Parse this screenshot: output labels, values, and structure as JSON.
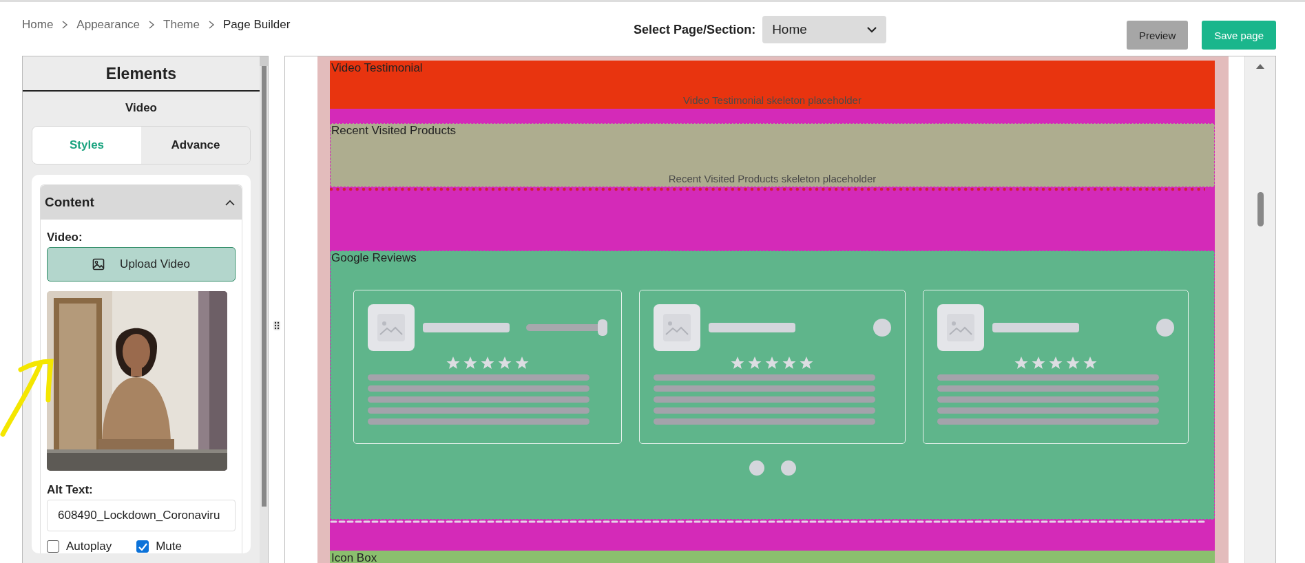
{
  "breadcrumb": [
    {
      "label": "Home",
      "current": false
    },
    {
      "label": "Appearance",
      "current": false
    },
    {
      "label": "Theme",
      "current": false
    },
    {
      "label": "Page Builder",
      "current": true
    }
  ],
  "page_select": {
    "label": "Select Page/Section:",
    "value": "Home"
  },
  "buttons": [
    {
      "label": "Preview",
      "kind": "secondary"
    },
    {
      "label": "Save page",
      "kind": "primary"
    }
  ],
  "panel": {
    "title": "Elements",
    "element": "Video",
    "tabs": [
      {
        "label": "Styles",
        "selected": true
      },
      {
        "label": "Advance",
        "selected": false
      }
    ],
    "section": {
      "title": "Content",
      "expanded": true,
      "video_label": "Video:",
      "upload_button": "Upload Video",
      "alt_label": "Alt Text:",
      "alt_value": "608490_Lockdown_Coronaviru",
      "checkboxes": [
        {
          "label": "Autoplay",
          "checked": false
        },
        {
          "label": "Mute",
          "checked": true
        }
      ]
    }
  },
  "canvas": {
    "sections": [
      {
        "kind": "block",
        "title": "Video Testimonial",
        "placeholder": "Video Testimonial skeleton placeholder",
        "color": "#e8340f",
        "outlined": false
      },
      {
        "kind": "spacer",
        "color": "#d42ab8"
      },
      {
        "kind": "block",
        "title": "Recent Visited Products",
        "placeholder": "Recent Visited Products skeleton placeholder",
        "color": "#aead8f",
        "outlined": true
      },
      {
        "kind": "dotted_divider",
        "color": "#d42ab8"
      },
      {
        "kind": "reviews",
        "title": "Google Reviews",
        "color": "#5fb58b",
        "outlined": true,
        "cards": [
          {
            "kind": "slider"
          },
          {
            "kind": "dot"
          },
          {
            "kind": "dot"
          }
        ],
        "pager": [
          {
            "selected": false
          },
          {
            "selected": false
          }
        ]
      },
      {
        "kind": "dashed_divider",
        "color": "#d42ab8"
      },
      {
        "kind": "block",
        "title": "Icon Box",
        "color": "#8bbf6e",
        "outlined": false
      }
    ]
  }
}
